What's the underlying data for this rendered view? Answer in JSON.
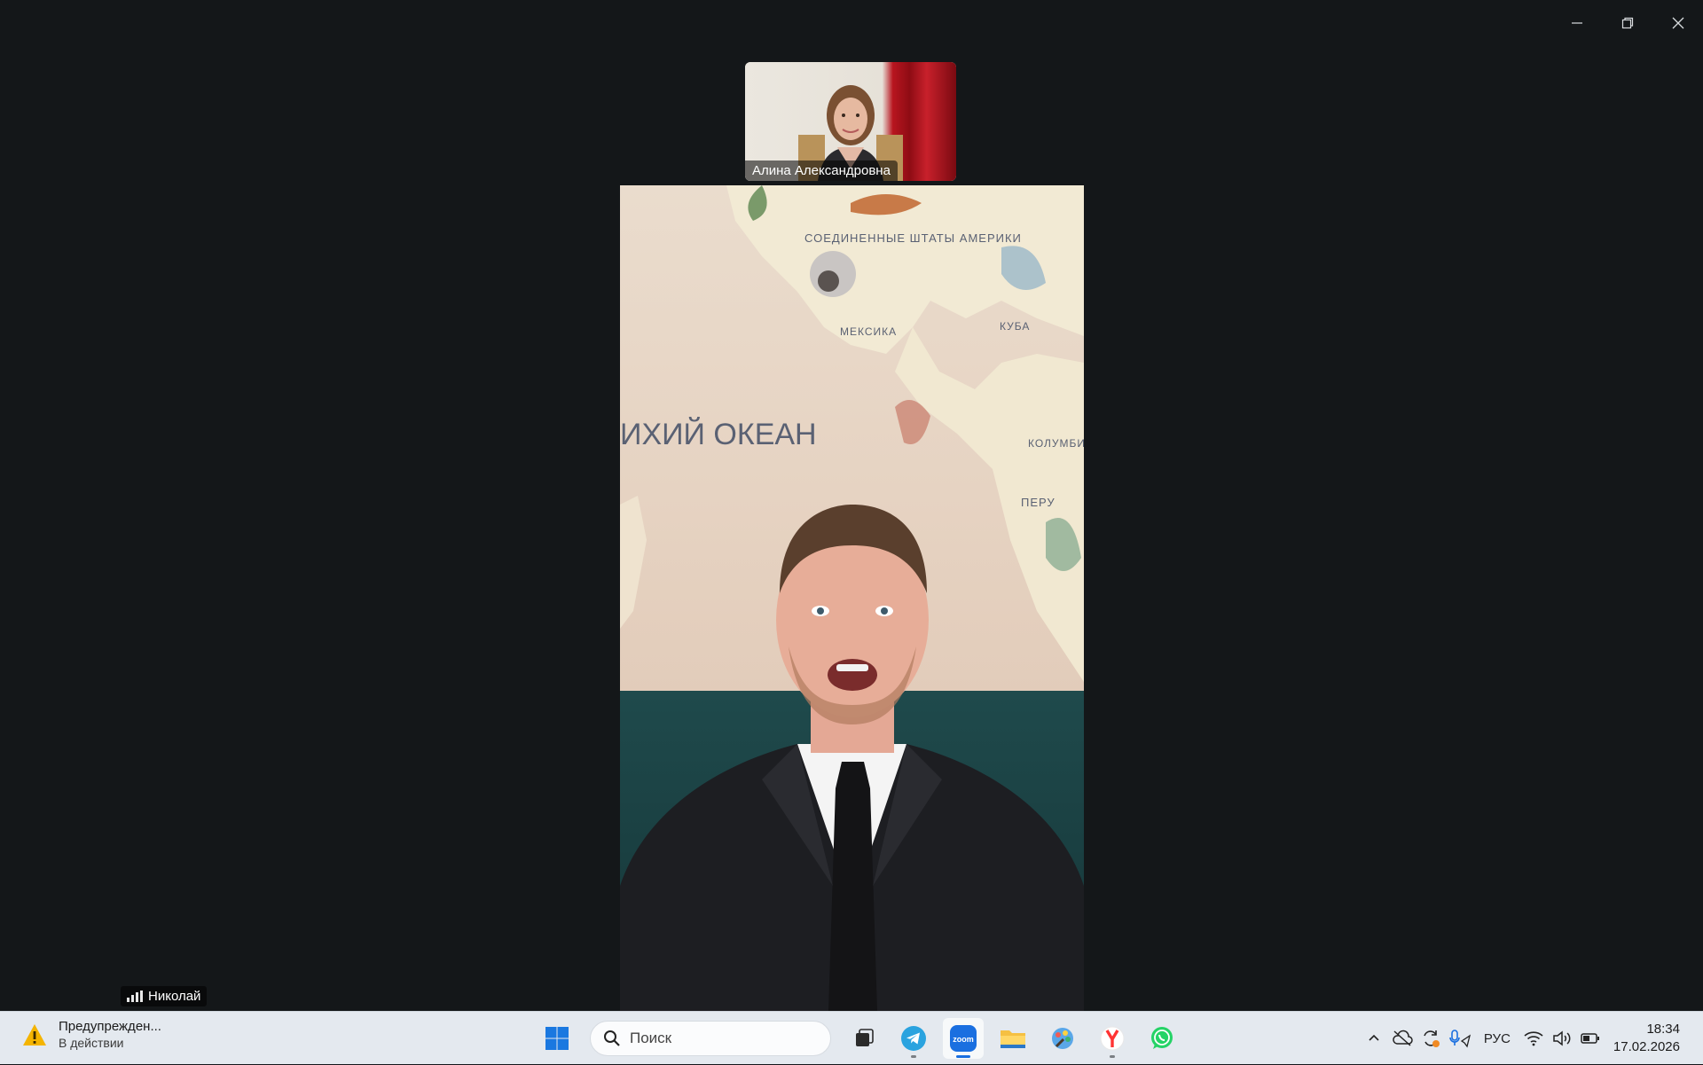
{
  "window": {
    "controls": {
      "minimize": "minimize",
      "restore": "restore",
      "close": "close"
    }
  },
  "participants": {
    "thumbnail": {
      "name": "Алина Александровна"
    },
    "active_speaker": {
      "name": "Николай"
    }
  },
  "background_map": {
    "labels": [
      "СОЕДИНЕННЫЕ ШТАТЫ АМЕРИКИ",
      "МЕКСИКА",
      "ИХИЙ ОКЕАН",
      "КУБА",
      "КОЛУМБИЯ",
      "ПЕРУ"
    ]
  },
  "taskbar": {
    "notification": {
      "title": "Предупрежден...",
      "subtitle": "В действии"
    },
    "search": {
      "placeholder": "Поиск"
    },
    "pinned_apps": [
      "start-icon",
      "task-view-icon",
      "telegram-icon",
      "zoom-icon",
      "file-explorer-icon",
      "paint-icon",
      "yandex-browser-icon",
      "whatsapp-icon"
    ],
    "active_app": "zoom-icon",
    "zoom_label": "zoom",
    "language": "РУС",
    "time": "18:34",
    "date": "17.02.2026"
  },
  "colors": {
    "stage_bg": "#141719",
    "taskbar_bg": "#e4e9ef",
    "accent": "#1a6fe0",
    "telegram": "#2aa3df",
    "whatsapp": "#25d366",
    "yandex": "#ff3333"
  }
}
